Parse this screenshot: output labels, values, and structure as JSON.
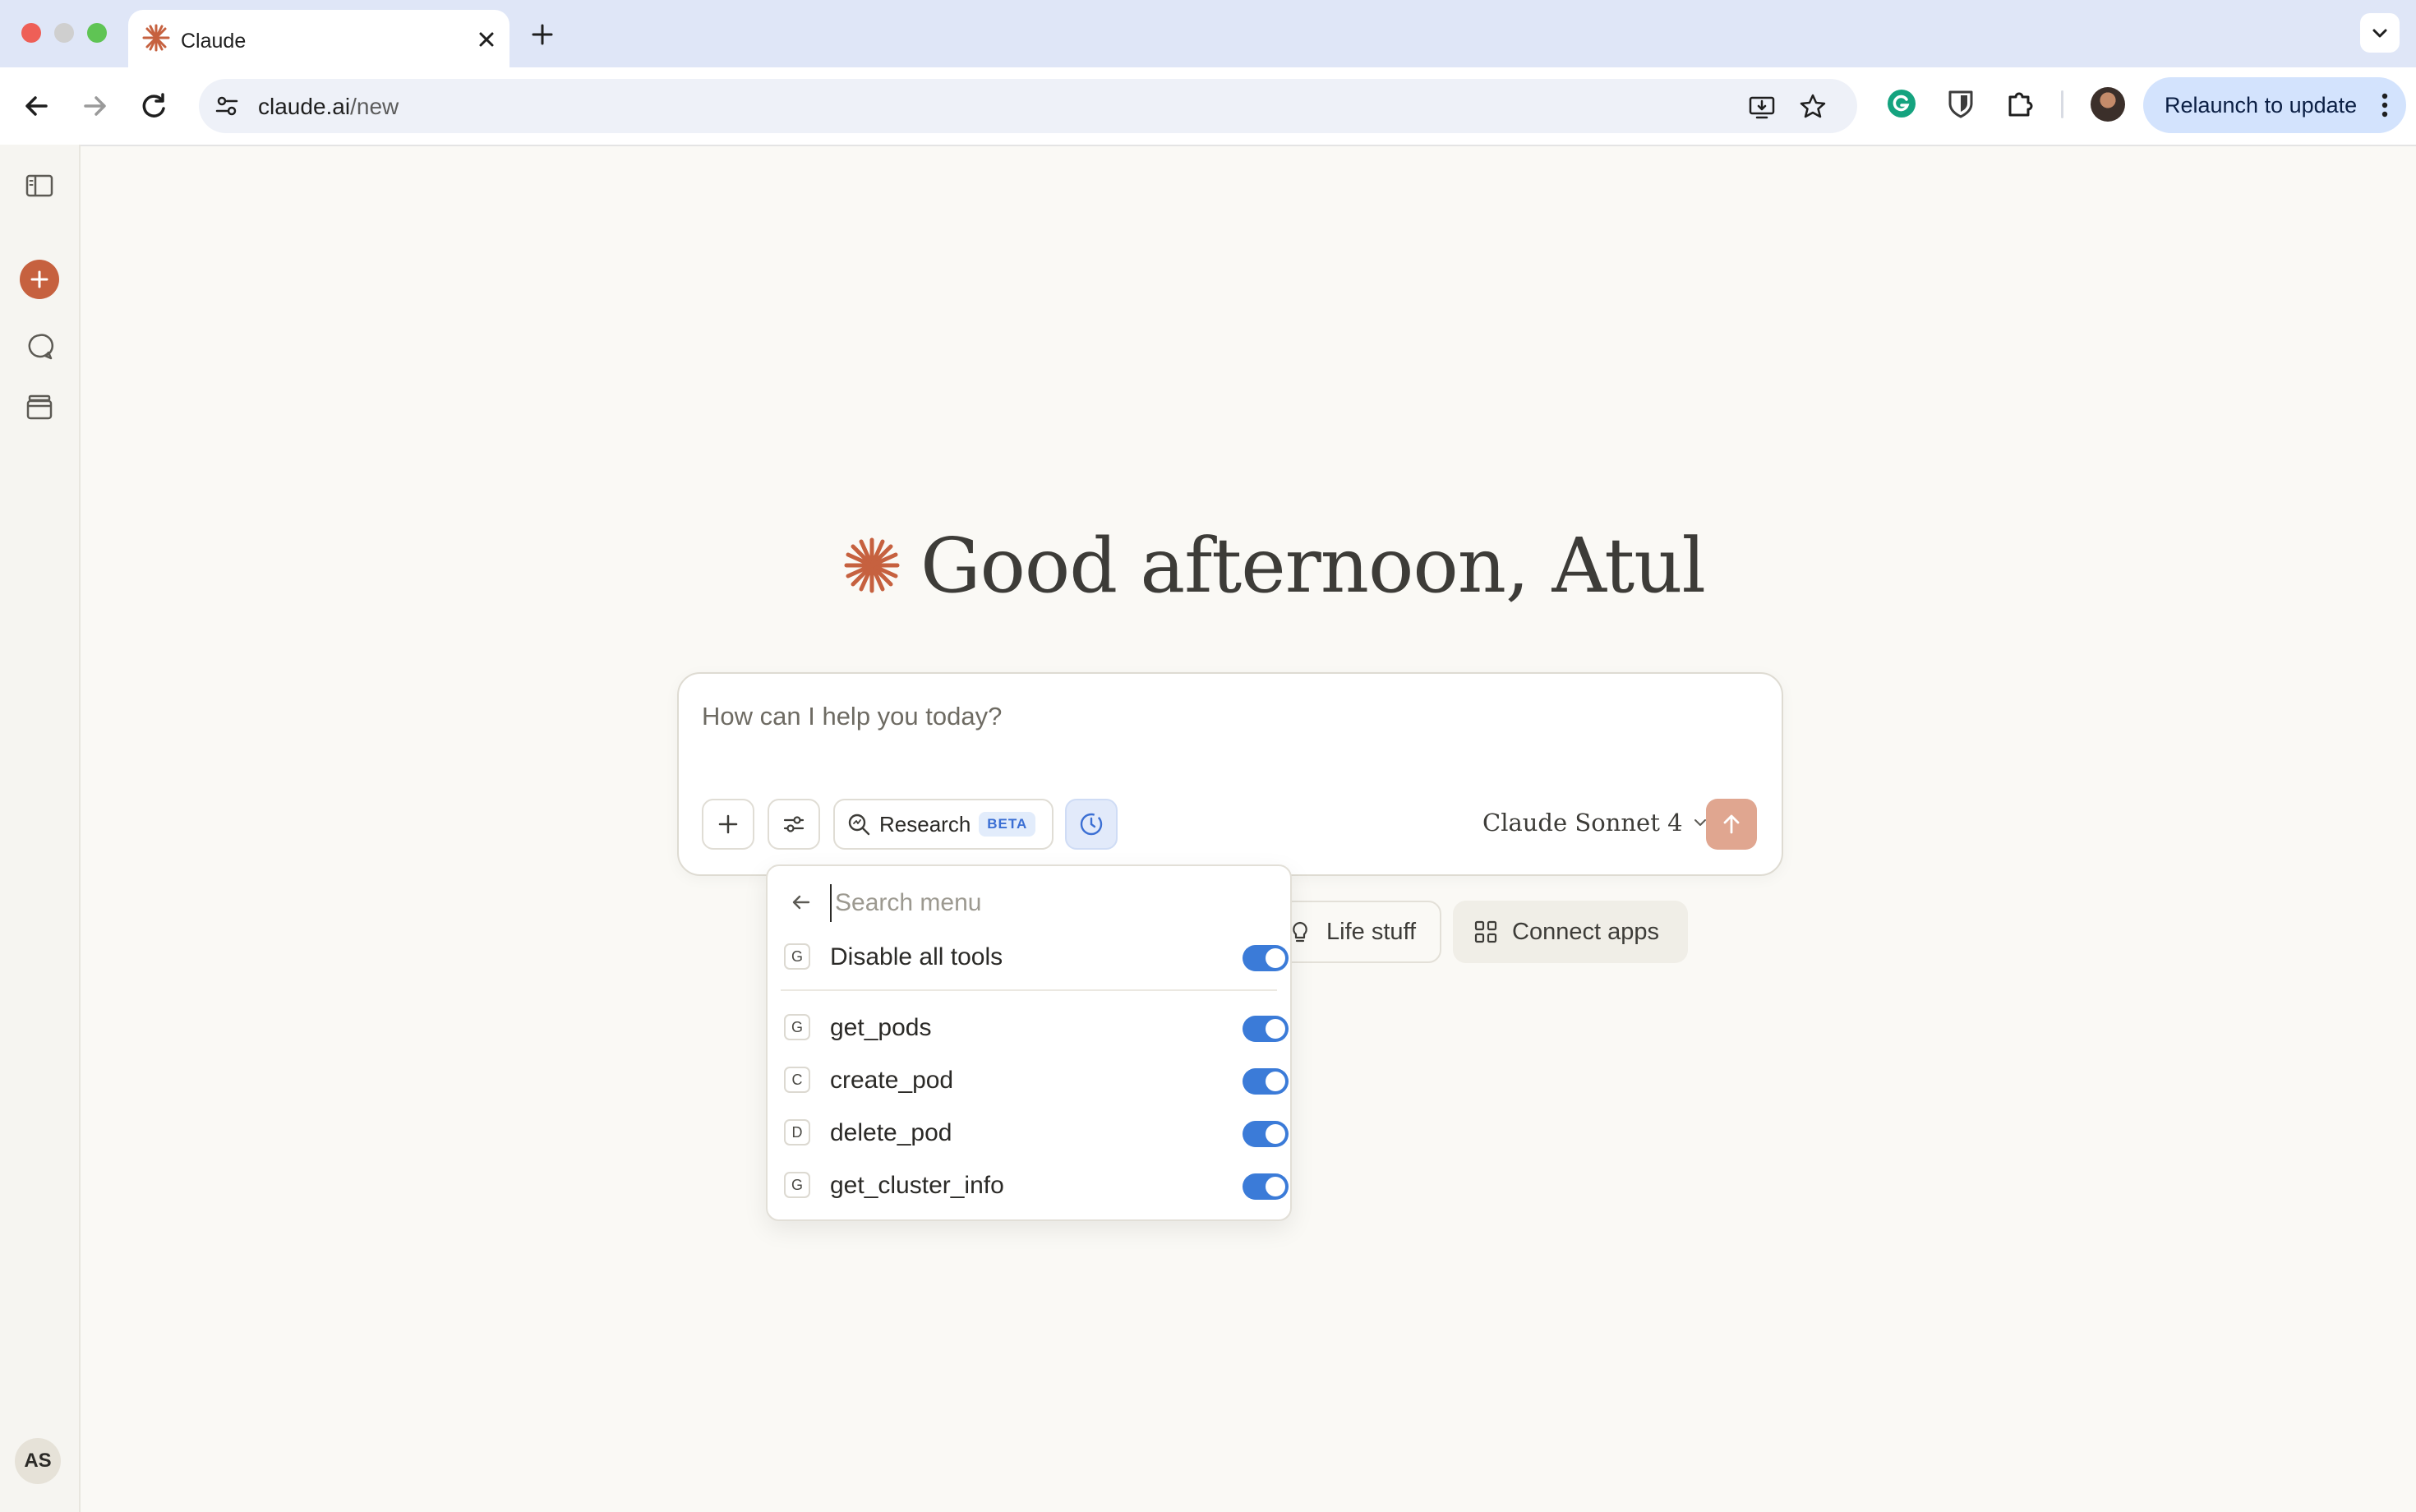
{
  "browser": {
    "tab_title": "Claude",
    "url_host": "claude.ai",
    "url_path": "/new",
    "relaunch_label": "Relaunch to update"
  },
  "sidebar": {
    "avatar_initials": "AS"
  },
  "main": {
    "greeting": "Good afternoon, Atul",
    "prompt_placeholder": "How can I help you today?",
    "research_label": "Research",
    "research_badge": "BETA",
    "model_name": "Claude Sonnet 4",
    "chips": [
      {
        "label": "Life stuff",
        "icon": "lightbulb-icon"
      },
      {
        "label": "Connect apps",
        "icon": "grid-icon"
      }
    ]
  },
  "tools_menu": {
    "search_placeholder": "Search menu",
    "disable_all": {
      "badge": "G",
      "label": "Disable all tools",
      "enabled": true
    },
    "tools": [
      {
        "badge": "G",
        "name": "get_pods",
        "enabled": true
      },
      {
        "badge": "C",
        "name": "create_pod",
        "enabled": true
      },
      {
        "badge": "D",
        "name": "delete_pod",
        "enabled": true
      },
      {
        "badge": "G",
        "name": "get_cluster_info",
        "enabled": true
      }
    ]
  },
  "colors": {
    "brand_orange": "#c6613f",
    "toggle_on": "#3b7bd8",
    "send_button": "#e0a690",
    "page_background": "#faf9f5",
    "relaunch_background": "#d3e3fd"
  }
}
